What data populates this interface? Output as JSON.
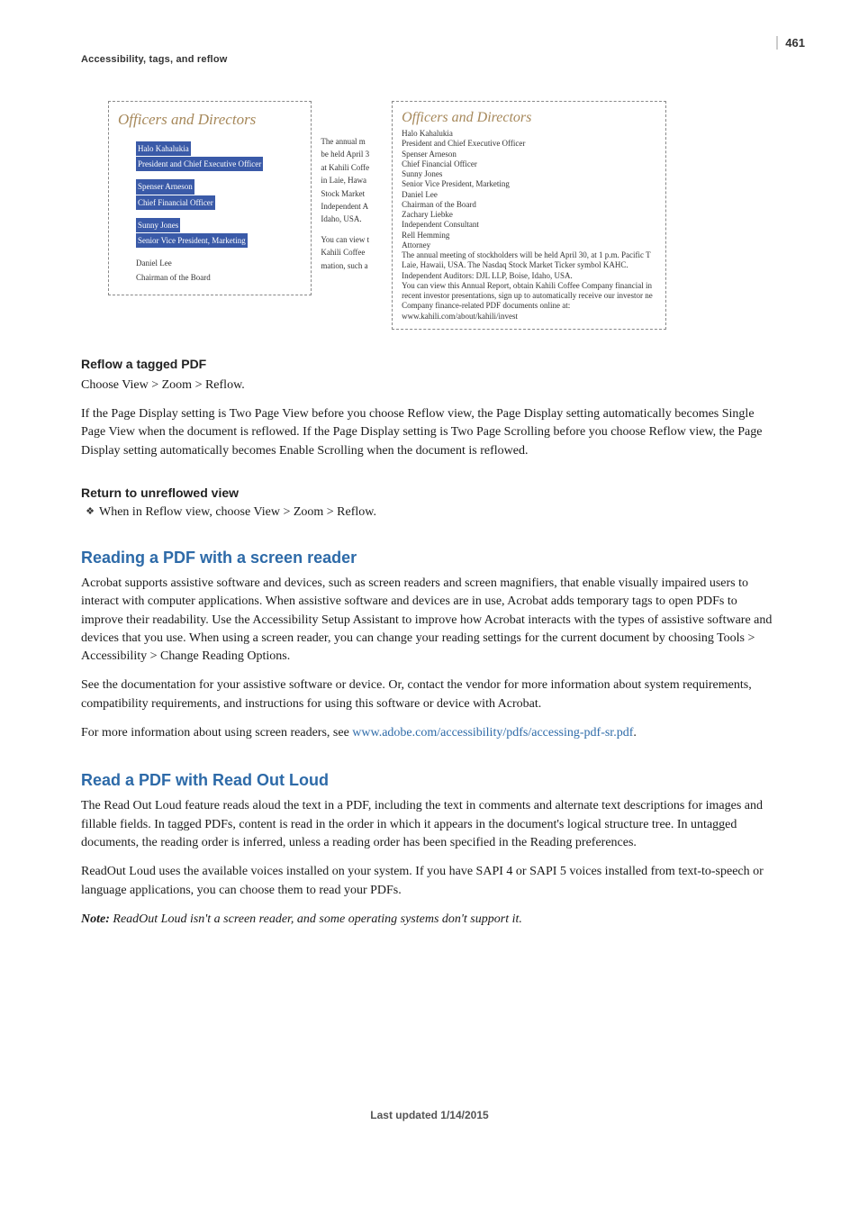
{
  "page_number": "461",
  "breadcrumb": "Accessibility, tags, and reflow",
  "figure": {
    "left_title": "Officers and Directors",
    "left_items": [
      {
        "name": "Halo Kahalukia",
        "role": "President and Chief Executive Officer"
      },
      {
        "name": "Spenser Arneson",
        "role": "Chief Financial Officer"
      },
      {
        "name": "Sunny Jones",
        "role": "Senior Vice President, Marketing"
      }
    ],
    "left_bottom_name": "Daniel Lee",
    "left_bottom_role": "Chairman of the Board",
    "mid_lines": [
      "The annual m",
      "be held April 3",
      "at Kahili Coffe",
      "in Laie, Hawa",
      "Stock Market",
      "Independent A",
      "Idaho, USA.",
      "",
      "You can view t",
      "Kahili Coffee",
      "mation, such a"
    ],
    "right_title": "Officers and Directors",
    "right_lines": [
      "Halo Kahalukia",
      "President and Chief Executive Officer",
      "Spenser Arneson",
      "Chief Financial Officer",
      "Sunny Jones",
      "Senior Vice President, Marketing",
      "Daniel Lee",
      "Chairman of the Board",
      "Zachary Liebke",
      "Independent Consultant",
      "Rell Hemming",
      "Attorney",
      "The annual meeting of stockholders will be held April 30, at 1 p.m. Pacific T",
      "Laie, Hawaii, USA. The Nasdaq Stock Market Ticker symbol KAHC.",
      "Independent Auditors: DJL LLP, Boise, Idaho, USA.",
      "You can view this Annual Report, obtain Kahili Coffee Company financial in",
      "recent investor presentations, sign up to automatically receive our investor ne",
      "Company finance-related PDF documents online at:",
      "www.kahili.com/about/kahili/invest"
    ]
  },
  "s1": {
    "heading": "Reflow a tagged PDF",
    "p1": "Choose View > Zoom > Reflow.",
    "p2": "If the Page Display setting is Two Page View before you choose Reflow view, the Page Display setting automatically becomes Single Page View when the document is reflowed. If the Page Display setting is Two Page Scrolling before you choose Reflow view, the Page Display setting automatically becomes Enable Scrolling when the document is reflowed."
  },
  "s2": {
    "heading": "Return to unreflowed view",
    "bullet": "When in Reflow view, choose View > Zoom > Reflow."
  },
  "s3": {
    "heading": "Reading a PDF with a screen reader",
    "p1": "Acrobat supports assistive software and devices, such as screen readers and screen magnifiers, that enable visually impaired users to interact with computer applications. When assistive software and devices are in use, Acrobat adds temporary tags to open PDFs to improve their readability. Use the Accessibility Setup Assistant to improve how Acrobat interacts with the types of assistive software and devices that you use. When using a screen reader, you can change your reading settings for the current document by choosing Tools > Accessibility > Change Reading Options.",
    "p2": "See the documentation for your assistive software or device. Or, contact the vendor for more information about system requirements, compatibility requirements, and instructions for using this software or device with Acrobat.",
    "p3_prefix": "For more information about using screen readers, see ",
    "p3_link": "www.adobe.com/accessibility/pdfs/accessing-pdf-sr.pdf",
    "p3_suffix": "."
  },
  "s4": {
    "heading": "Read a PDF with Read Out Loud",
    "p1": "The Read Out Loud feature reads aloud the text in a PDF, including the text in comments and alternate text descriptions for images and fillable fields. In tagged PDFs, content is read in the order in which it appears in the document's logical structure tree. In untagged documents, the reading order is inferred, unless a reading order has been specified in the Reading preferences.",
    "p2": "ReadOut Loud uses the available voices installed on your system. If you have SAPI 4 or SAPI 5 voices installed from text-to-speech or language applications, you can choose them to read your PDFs.",
    "note_label": "Note:",
    "note_text": " ReadOut Loud isn't a screen reader, and some operating systems don't support it."
  },
  "footer": "Last updated 1/14/2015"
}
